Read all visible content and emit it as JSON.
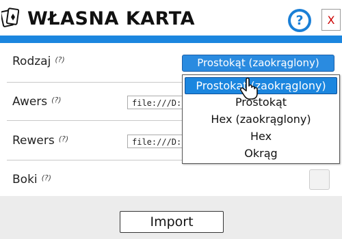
{
  "window": {
    "title": "WŁASNA KARTA",
    "help_label": "?",
    "close_label": "X"
  },
  "form": {
    "rodzaj": {
      "label": "Rodzaj",
      "hint": "(?)",
      "selected": "Prostokąt (zaokrąglony)"
    },
    "awers": {
      "label": "Awers",
      "hint": "(?)",
      "value": "file:///D:\\("
    },
    "rewers": {
      "label": "Rewers",
      "hint": "(?)",
      "value": "file:///D:\\("
    },
    "boki": {
      "label": "Boki",
      "hint": "(?)",
      "checked": false
    }
  },
  "dropdown": {
    "options": [
      "Prostokąt (zaokrąglony)",
      "Prostokąt",
      "Hex (zaokrąglony)",
      "Hex",
      "Okrąg"
    ],
    "highlighted_index": 0
  },
  "actions": {
    "import_label": "Import"
  },
  "colors": {
    "accent": "#1b86df",
    "close_text": "#cc0000"
  },
  "icons": {
    "app": "playing-cards-icon",
    "help": "question-circle-icon",
    "cursor": "hand-pointer-icon"
  }
}
